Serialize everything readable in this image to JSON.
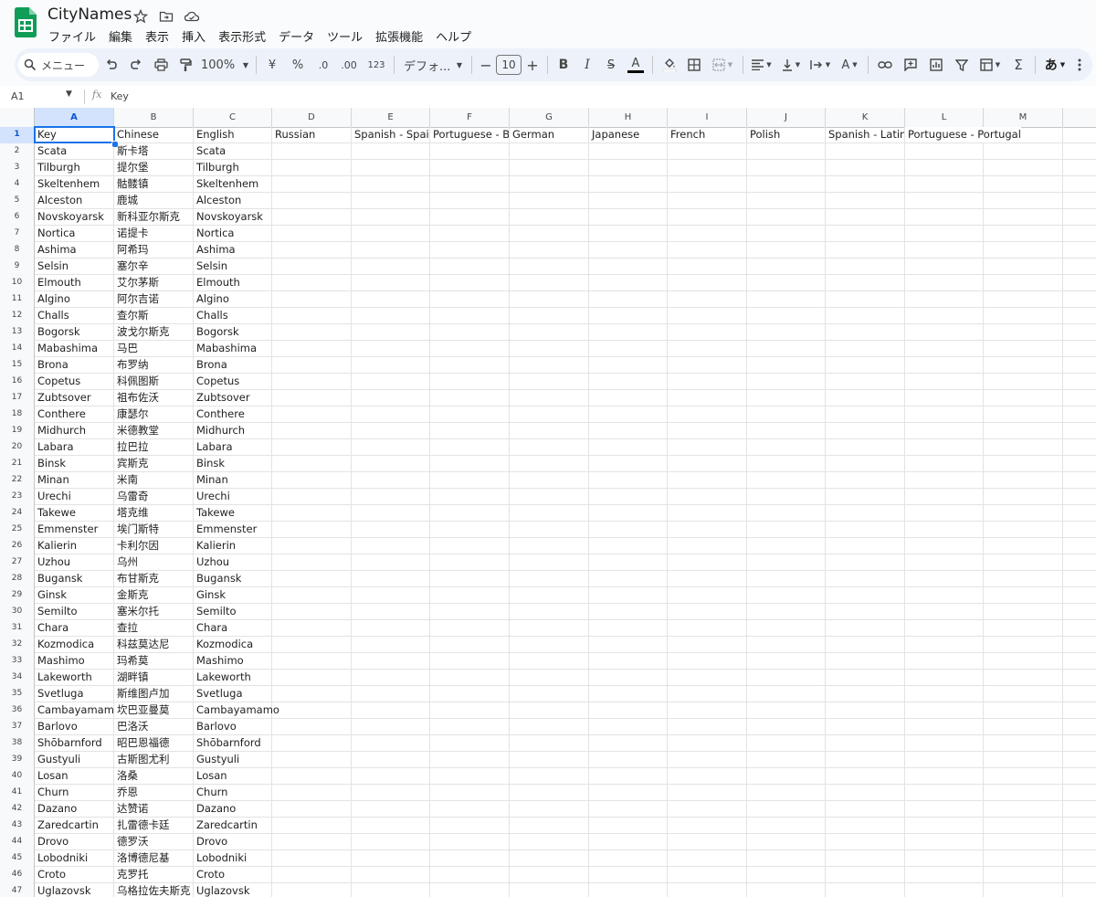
{
  "app": {
    "title": "CityNames",
    "menus": [
      "ファイル",
      "編集",
      "表示",
      "挿入",
      "表示形式",
      "データ",
      "ツール",
      "拡張機能",
      "ヘルプ"
    ]
  },
  "toolbar": {
    "search_label": "メニュー",
    "zoom": "100%",
    "currency": "¥",
    "percent": "%",
    "dec_decrease": ".0",
    "dec_increase": ".00",
    "number_format": "123",
    "font": "デフォ...",
    "font_size": "10",
    "input_tool": "あ"
  },
  "formula_bar": {
    "cell_ref": "A1",
    "fx": "fx",
    "value": "Key"
  },
  "sheet": {
    "columns": [
      "A",
      "B",
      "C",
      "D",
      "E",
      "F",
      "G",
      "H",
      "I",
      "J",
      "K",
      "L",
      "M"
    ],
    "header_row": [
      "Key",
      "Chinese",
      "English",
      "Russian",
      "Spanish - Spain",
      "Portuguese - Brazil",
      "German",
      "Japanese",
      "French",
      "Polish",
      "Spanish - Latin America",
      "Portuguese - Portugal",
      ""
    ],
    "rows": [
      [
        "Scata",
        "斯卡塔",
        "Scata"
      ],
      [
        "Tilburgh",
        "提尔堡",
        "Tilburgh"
      ],
      [
        "Skeltenhem",
        "骷髅镇",
        "Skeltenhem"
      ],
      [
        "Alceston",
        "鹿城",
        "Alceston"
      ],
      [
        "Novskoyarsk",
        "新科亚尔斯克",
        "Novskoyarsk"
      ],
      [
        "Nortica",
        "诺提卡",
        "Nortica"
      ],
      [
        "Ashima",
        "阿希玛",
        "Ashima"
      ],
      [
        "Selsin",
        "塞尔辛",
        "Selsin"
      ],
      [
        "Elmouth",
        "艾尔茅斯",
        "Elmouth"
      ],
      [
        "Algino",
        "阿尔吉诺",
        "Algino"
      ],
      [
        "Challs",
        "查尔斯",
        "Challs"
      ],
      [
        "Bogorsk",
        "波戈尔斯克",
        "Bogorsk"
      ],
      [
        "Mabashima",
        "马巴",
        "Mabashima"
      ],
      [
        "Brona",
        "布罗纳",
        "Brona"
      ],
      [
        "Copetus",
        "科佩图斯",
        "Copetus"
      ],
      [
        "Zubtsover",
        "祖布佐沃",
        "Zubtsover"
      ],
      [
        "Conthere",
        "康瑟尔",
        "Conthere"
      ],
      [
        "Midhurch",
        "米德教堂",
        "Midhurch"
      ],
      [
        "Labara",
        "拉巴拉",
        "Labara"
      ],
      [
        "Binsk",
        "宾斯克",
        "Binsk"
      ],
      [
        "Minan",
        "米南",
        "Minan"
      ],
      [
        "Urechi",
        "乌雷奇",
        "Urechi"
      ],
      [
        "Takewe",
        "塔克维",
        "Takewe"
      ],
      [
        "Emmenster",
        "埃门斯特",
        "Emmenster"
      ],
      [
        "Kalierin",
        "卡利尔因",
        "Kalierin"
      ],
      [
        "Uzhou",
        "乌州",
        "Uzhou"
      ],
      [
        "Bugansk",
        "布甘斯克",
        "Bugansk"
      ],
      [
        "Ginsk",
        "金斯克",
        "Ginsk"
      ],
      [
        "Semilto",
        "塞米尔托",
        "Semilto"
      ],
      [
        "Chara",
        "查拉",
        "Chara"
      ],
      [
        "Kozmodica",
        "科兹莫达尼",
        "Kozmodica"
      ],
      [
        "Mashimo",
        "玛希莫",
        "Mashimo"
      ],
      [
        "Lakeworth",
        "湖畔镇",
        "Lakeworth"
      ],
      [
        "Svetluga",
        "斯维图卢加",
        "Svetluga"
      ],
      [
        "Cambayamamo",
        "坎巴亚曼莫",
        "Cambayamamo"
      ],
      [
        "Barlovo",
        "巴洛沃",
        "Barlovo"
      ],
      [
        "Shōbarnford",
        "昭巴恩福德",
        "Shōbarnford"
      ],
      [
        "Gustyuli",
        "古斯图尤利",
        "Gustyuli"
      ],
      [
        "Losan",
        "洛桑",
        "Losan"
      ],
      [
        "Churn",
        "乔恩",
        "Churn"
      ],
      [
        "Dazano",
        "达赞诺",
        "Dazano"
      ],
      [
        "Zaredcartin",
        "扎雷德卡廷",
        "Zaredcartin"
      ],
      [
        "Drovo",
        "德罗沃",
        "Drovo"
      ],
      [
        "Lobodniki",
        "洛博德尼基",
        "Lobodniki"
      ],
      [
        "Croto",
        "克罗托",
        "Croto"
      ],
      [
        "Uglazovsk",
        "乌格拉佐夫斯克",
        "Uglazovsk"
      ]
    ]
  },
  "colors": {
    "accent": "#1a73e8",
    "sheets_green": "#0f9d58"
  }
}
